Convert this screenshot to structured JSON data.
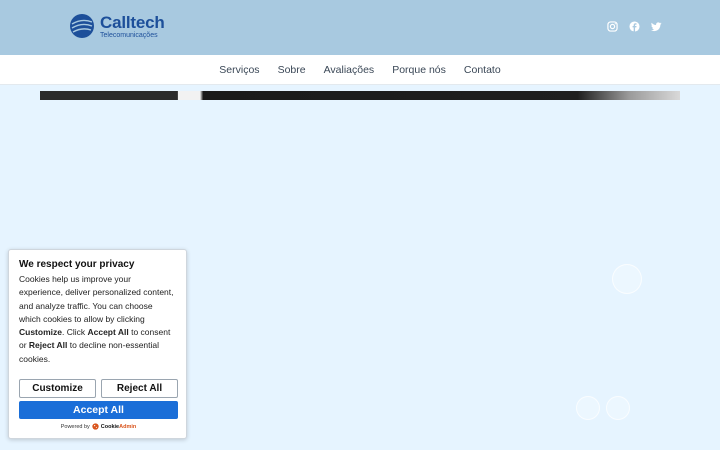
{
  "brand": {
    "name": "Calltech",
    "tagline": "Telecomunicações",
    "colors": {
      "primary": "#1d4f9a",
      "header_bg": "#a8c9e0",
      "page_bg": "#e6f4ff",
      "accept": "#1a6ed8"
    }
  },
  "social": {
    "icons": [
      "instagram-icon",
      "facebook-icon",
      "twitter-icon"
    ]
  },
  "nav": {
    "items": [
      "Serviços",
      "Sobre",
      "Avaliações",
      "Porque nós",
      "Contato"
    ]
  },
  "cookie_banner": {
    "title": "We respect your privacy",
    "text_part1": "Cookies help us improve your experience, deliver personalized content, and analyze traffic. You can choose which cookies to allow by clicking ",
    "customize_word": "Customize",
    "text_part2": ". Click ",
    "accept_word": "Accept All",
    "text_part3": " to consent or ",
    "reject_word": "Reject All",
    "text_part4": " to decline non-essential cookies.",
    "customize_label": "Customize",
    "reject_label": "Reject All",
    "accept_label": "Accept All",
    "powered_by": "Powered by",
    "provider_prefix": "Cookie",
    "provider_suffix": "Admin"
  }
}
